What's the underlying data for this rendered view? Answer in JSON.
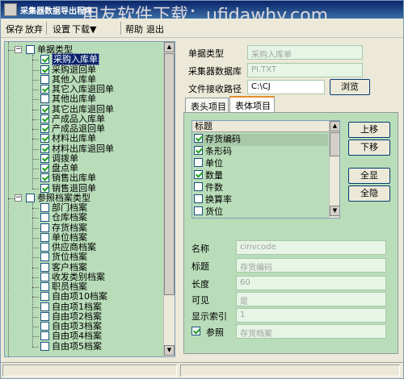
{
  "titlebar": {
    "title": "采集器数据导出程序",
    "watermark": "用友软件下载：ufidawhy.com"
  },
  "toolbar": {
    "items": [
      "保存",
      "放弃",
      "设置",
      "下载▼",
      "帮助",
      "退出"
    ]
  },
  "tree": {
    "groups": [
      {
        "label": "单据类型",
        "checked": false,
        "items": [
          {
            "label": "采购入库单",
            "checked": true,
            "selected": true
          },
          {
            "label": "采购退回单",
            "checked": true
          },
          {
            "label": "其他入库单",
            "checked": false
          },
          {
            "label": "其它入库退回单",
            "checked": true
          },
          {
            "label": "其他出库单",
            "checked": false
          },
          {
            "label": "其它出库退回单",
            "checked": true
          },
          {
            "label": "产成品入库单",
            "checked": true
          },
          {
            "label": "产成品退回单",
            "checked": true
          },
          {
            "label": "材料出库单",
            "checked": true
          },
          {
            "label": "材料出库退回单",
            "checked": true
          },
          {
            "label": "调拨单",
            "checked": true
          },
          {
            "label": "盘点单",
            "checked": true
          },
          {
            "label": "销售出库单",
            "checked": true
          },
          {
            "label": "销售退回单",
            "checked": true
          }
        ]
      },
      {
        "label": "参照档案类型",
        "checked": false,
        "items": [
          {
            "label": "部门档案",
            "checked": false
          },
          {
            "label": "仓库档案",
            "checked": false
          },
          {
            "label": "存货档案",
            "checked": false
          },
          {
            "label": "单位档案",
            "checked": false
          },
          {
            "label": "供应商档案",
            "checked": false
          },
          {
            "label": "货位档案",
            "checked": false
          },
          {
            "label": "客户档案",
            "checked": false
          },
          {
            "label": "收发类别档案",
            "checked": false
          },
          {
            "label": "职员档案",
            "checked": false
          },
          {
            "label": "自由项10档案",
            "checked": false
          },
          {
            "label": "自由项1档案",
            "checked": false
          },
          {
            "label": "自由项2档案",
            "checked": false
          },
          {
            "label": "自由项3档案",
            "checked": false
          },
          {
            "label": "自由项4档案",
            "checked": false
          },
          {
            "label": "自由项5档案",
            "checked": false
          }
        ]
      }
    ]
  },
  "form": {
    "doc_type_label": "单据类型",
    "doc_type_value": "采购入库单",
    "db_label": "采集器数据库",
    "db_value": "PI.TXT",
    "path_label": "文件接收路径",
    "path_value": "C:\\CJ",
    "browse_label": "浏览"
  },
  "tabs": [
    "表头项目",
    "表体项目"
  ],
  "list": {
    "header": "标题",
    "rows": [
      {
        "label": "存货编码",
        "checked": true,
        "selected": true
      },
      {
        "label": "条形码",
        "checked": true
      },
      {
        "label": "单位",
        "checked": false
      },
      {
        "label": "数量",
        "checked": true
      },
      {
        "label": "件数",
        "checked": false
      },
      {
        "label": "换算率",
        "checked": false
      },
      {
        "label": "货位",
        "checked": false
      }
    ]
  },
  "buttons": {
    "up": "上移",
    "down": "下移",
    "show_all": "全显",
    "hide_all": "全隐"
  },
  "props": {
    "name_label": "名称",
    "name_value": "cinvcode",
    "title_label": "标题",
    "title_value": "存货编码",
    "length_label": "长度",
    "length_value": "60",
    "visible_label": "可见",
    "visible_value": "是",
    "index_label": "显示索引",
    "index_value": "1",
    "ref_label": "参照",
    "ref_checked": true,
    "ref_value": "存货档案"
  }
}
